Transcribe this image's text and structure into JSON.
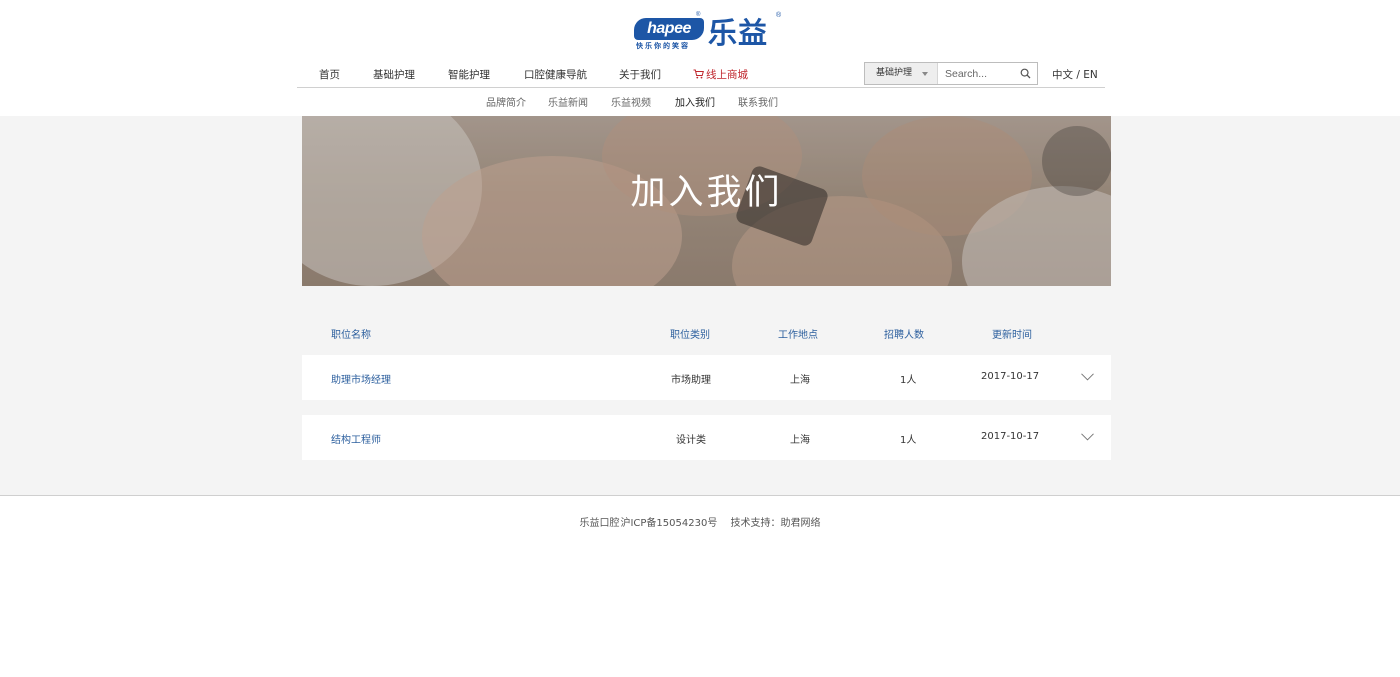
{
  "brand": {
    "logo_en": "hapee",
    "logo_cn": "乐益",
    "slogan": "快乐你的笑容",
    "reg_mark": "®"
  },
  "nav": {
    "items": [
      {
        "label": "首页"
      },
      {
        "label": "基础护理"
      },
      {
        "label": "智能护理"
      },
      {
        "label": "口腔健康导航"
      },
      {
        "label": "关于我们"
      },
      {
        "label": "线上商城"
      }
    ],
    "mall_color": "#c0262d"
  },
  "search": {
    "category": "基础护理",
    "placeholder": "Search..."
  },
  "lang": {
    "zh": "中文",
    "separator": "/",
    "en": "EN"
  },
  "subnav": {
    "items": [
      {
        "label": "品牌简介"
      },
      {
        "label": "乐益新闻"
      },
      {
        "label": "乐益视频"
      },
      {
        "label": "加入我们"
      },
      {
        "label": "联系我们"
      }
    ],
    "active_index": 3
  },
  "banner": {
    "title": "加入我们"
  },
  "jobs": {
    "headers": [
      "职位名称",
      "职位类别",
      "工作地点",
      "招聘人数",
      "更新时间"
    ],
    "rows": [
      {
        "title": "助理市场经理",
        "category": "市场助理",
        "location": "上海",
        "count": "1人",
        "date": "2017-10-17"
      },
      {
        "title": "结构工程师",
        "category": "设计类",
        "location": "上海",
        "count": "1人",
        "date": "2017-10-17"
      }
    ]
  },
  "footer": {
    "company": "乐益口腔",
    "icp": "沪ICP备15054230号",
    "support": "技术支持：助君网络"
  },
  "colors": {
    "brand_blue": "#1d56a6",
    "link_blue": "#2c5f9e",
    "page_gray": "#f4f4f4"
  }
}
